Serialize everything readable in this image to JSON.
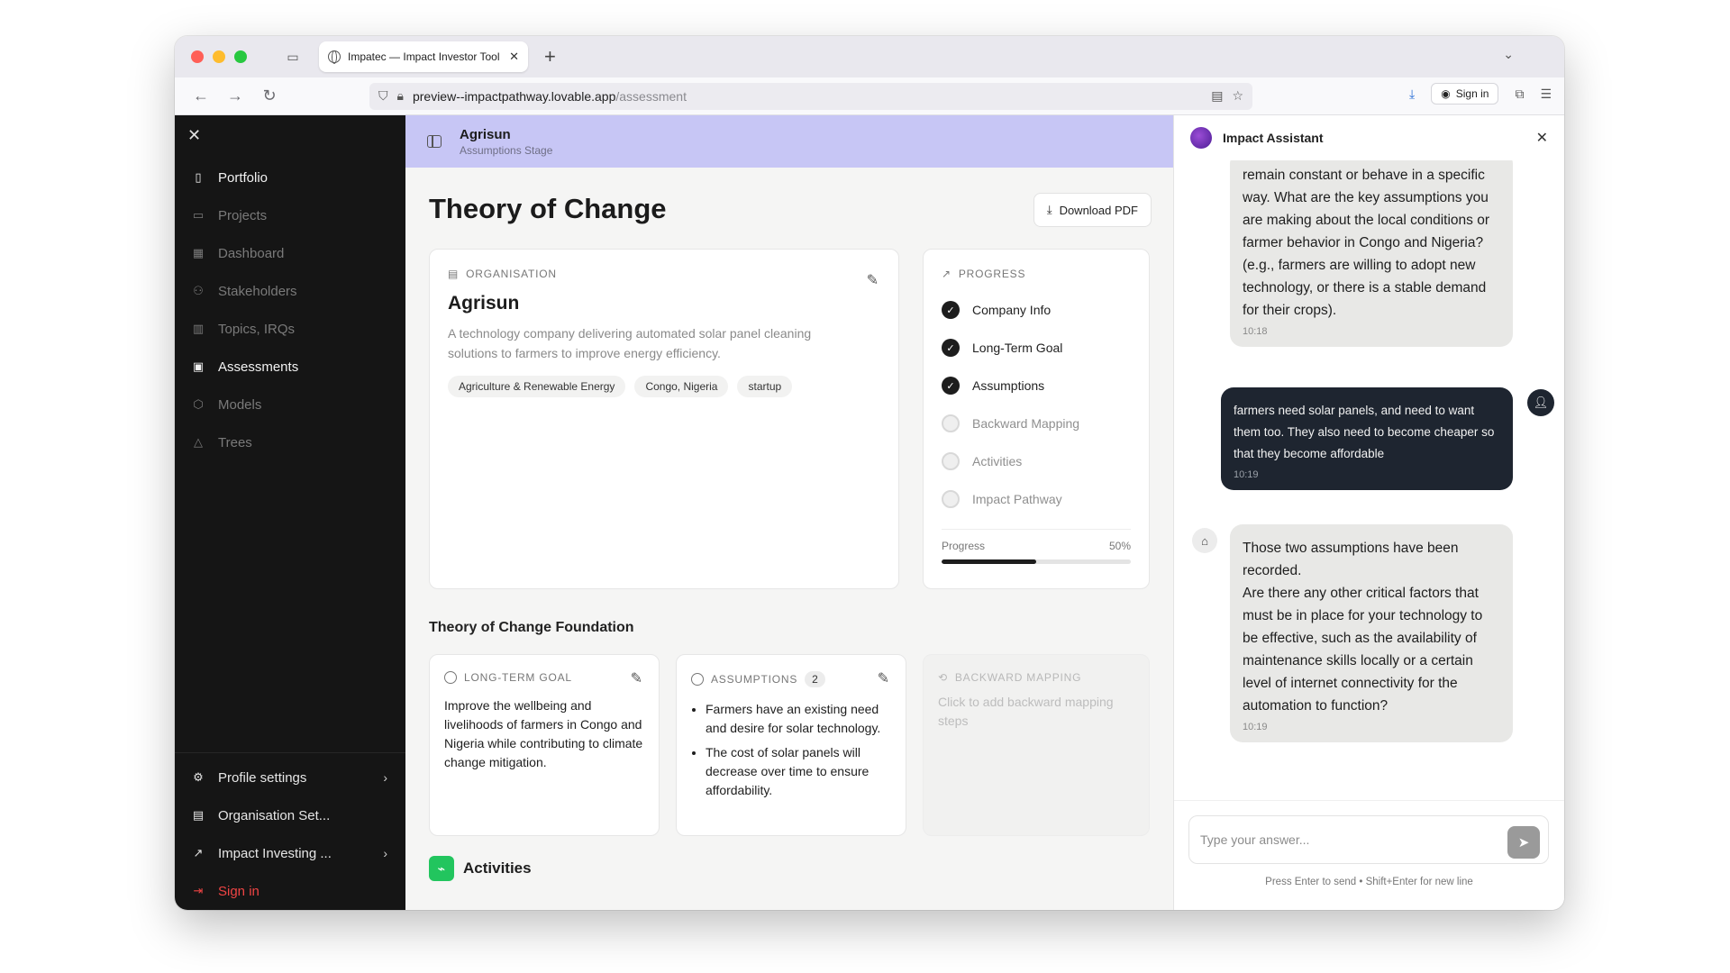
{
  "browser": {
    "tab_title": "Impatec — Impact Investor Tool",
    "url_host": "preview--impactpathway.lovable.app",
    "url_path": "/assessment",
    "signin_label": "Sign in",
    "colors": {
      "close": "#ff5f57",
      "minimize": "#febc2e",
      "zoom": "#28c840"
    }
  },
  "sidebar": {
    "items": [
      {
        "label": "Portfolio",
        "icon": "book-icon",
        "active": true
      },
      {
        "label": "Projects",
        "icon": "folder-icon",
        "active": false
      },
      {
        "label": "Dashboard",
        "icon": "grid-icon",
        "active": false
      },
      {
        "label": "Stakeholders",
        "icon": "users-icon",
        "active": false
      },
      {
        "label": "Topics, IRQs",
        "icon": "open-book-icon",
        "active": false
      },
      {
        "label": "Assessments",
        "icon": "clipboard-icon",
        "active": true
      },
      {
        "label": "Models",
        "icon": "cube-icon",
        "active": false
      },
      {
        "label": "Trees",
        "icon": "triangle-icon",
        "active": false
      }
    ],
    "bottom": {
      "profile": "Profile settings",
      "organisation": "Organisation Set...",
      "impact": "Impact Investing ...",
      "signin": "Sign in"
    }
  },
  "header": {
    "company": "Agrisun",
    "stage": "Assumptions Stage"
  },
  "main": {
    "title": "Theory of Change",
    "download_label": "Download PDF",
    "org": {
      "caption": "ORGANISATION",
      "name": "Agrisun",
      "description": "A technology company delivering automated solar panel cleaning solutions to farmers to improve energy efficiency.",
      "tags": [
        "Agriculture & Renewable Energy",
        "Congo, Nigeria",
        "startup"
      ]
    },
    "progress": {
      "caption": "PROGRESS",
      "steps": [
        {
          "label": "Company Info",
          "done": true
        },
        {
          "label": "Long-Term Goal",
          "done": true
        },
        {
          "label": "Assumptions",
          "done": true
        },
        {
          "label": "Backward Mapping",
          "done": false
        },
        {
          "label": "Activities",
          "done": false
        },
        {
          "label": "Impact Pathway",
          "done": false
        }
      ],
      "label": "Progress",
      "value_text": "50%",
      "value": 0.5
    },
    "foundation": {
      "title": "Theory of Change Foundation",
      "goal": {
        "caption": "LONG-TERM GOAL",
        "text": "Improve the wellbeing and livelihoods of farmers in Congo and Nigeria while contributing to climate change mitigation."
      },
      "assumptions": {
        "caption": "ASSUMPTIONS",
        "count": "2",
        "items": [
          "Farmers have an existing need and desire for solar technology.",
          "The cost of solar panels will decrease over time to ensure affordability."
        ]
      },
      "backward": {
        "caption": "BACKWARD MAPPING",
        "hint": "Click to add backward mapping steps"
      }
    },
    "activities_label": "Activities"
  },
  "assistant": {
    "title": "Impact Assistant",
    "messages": [
      {
        "role": "bot",
        "text": "remain constant or behave in a specific way. What are the key assumptions you are making about the local conditions or farmer behavior in Congo and Nigeria? (e.g., farmers are willing to adopt new technology, or there is a stable demand for their crops).",
        "time": "10:18"
      },
      {
        "role": "user",
        "text": "farmers need solar panels, and need to want them too. They also need to become cheaper so that they become affordable",
        "time": "10:19"
      },
      {
        "role": "bot",
        "text_line1": "Those two assumptions have been recorded.",
        "text_line2": "Are there any other critical factors that must be in place for your technology to be effective, such as the availability of maintenance skills locally or a certain level of internet connectivity for the automation to function?",
        "time": "10:19"
      }
    ],
    "input_placeholder": "Type your answer...",
    "hint": "Press Enter to send • Shift+Enter for new line"
  }
}
